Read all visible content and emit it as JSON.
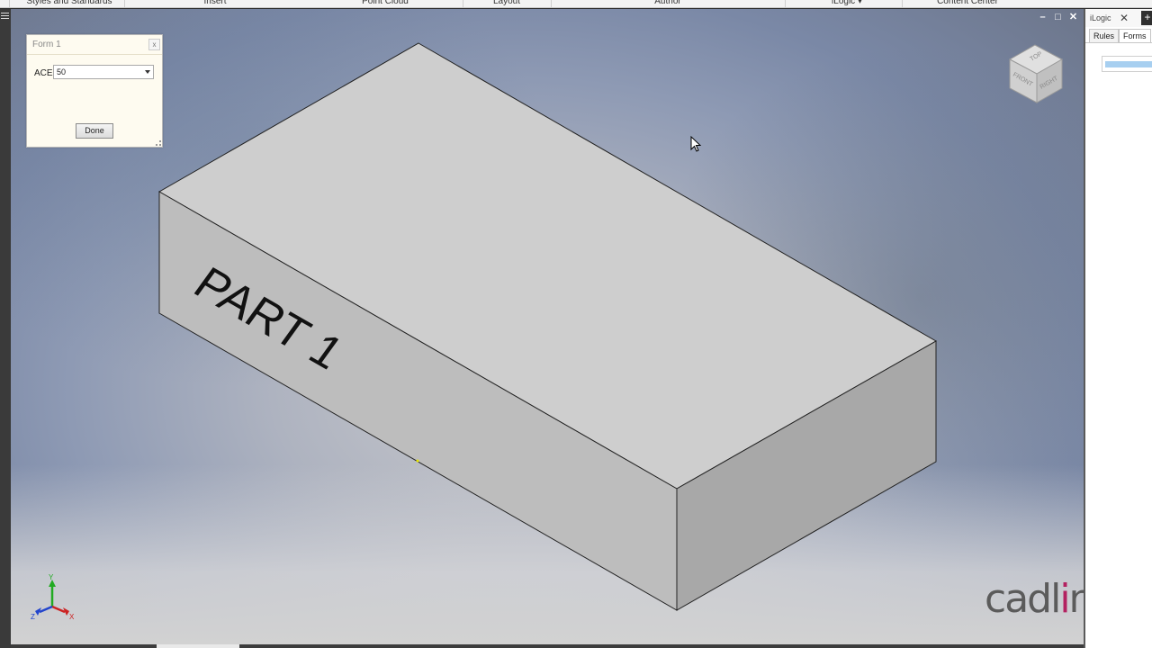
{
  "ribbon": {
    "tabs": [
      {
        "label": "Styles and Standards"
      },
      {
        "label": "Insert"
      },
      {
        "label": "Point Cloud"
      },
      {
        "label": "Layout"
      },
      {
        "label": "Author"
      },
      {
        "label": "iLogic ▾"
      },
      {
        "label": "Content Center"
      }
    ]
  },
  "viewport": {
    "window_controls": {
      "minimize": "–",
      "restore": "□",
      "close": "✕"
    },
    "part_text": "PART 1",
    "viewcube": {
      "top": "TOP",
      "front": "FRONT",
      "right": "RIGHT"
    },
    "triad": {
      "x": "X",
      "y": "Y",
      "z": "Z"
    }
  },
  "form": {
    "title": "Form 1",
    "close": "x",
    "field_label": "ACE",
    "field_value": "50",
    "done_label": "Done"
  },
  "ilogic_panel": {
    "title": "iLogic",
    "close": "✕",
    "add": "+",
    "tabs": [
      "Rules",
      "Forms"
    ],
    "active_tab": "Forms"
  },
  "logo": {
    "prefix": "cadl",
    "accent": "i",
    "suffix": "ne"
  },
  "colors": {
    "logo_gray": "#5b5b5b",
    "logo_accent": "#b32160",
    "axis_x": "#cc2222",
    "axis_y": "#22aa22",
    "axis_z": "#2244cc",
    "part_top": "#cecece",
    "part_front": "#bdbdbd",
    "part_side": "#a8a8a8"
  }
}
